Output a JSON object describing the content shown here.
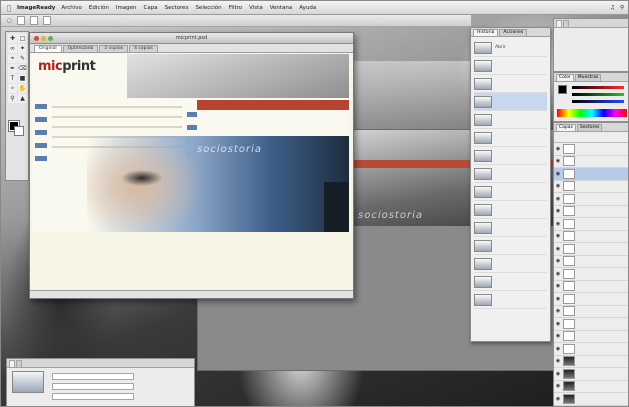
{
  "menubar": {
    "app_name": "ImageReady",
    "items": [
      "Archivo",
      "Edición",
      "Imagen",
      "Capa",
      "Sectores",
      "Selección",
      "Filtro",
      "Vista",
      "Ventana",
      "Ayuda"
    ]
  },
  "document": {
    "title": "micprint.psd",
    "tabs": [
      "Original",
      "Optimizada",
      "2 copias",
      "4 copias"
    ],
    "logo_part1": "mic",
    "logo_part2": "print",
    "hero_text": "sociostoria",
    "secondary_hero_text": "sociostoria"
  },
  "panels": {
    "history_tabs": [
      "Historia",
      "Acciones"
    ],
    "history_first_item": "Abrir",
    "color_tabs": [
      "Color",
      "Muestras"
    ],
    "layer_tabs": [
      "Capas",
      "Sectores"
    ]
  },
  "colors": {
    "logo_red": "#b22222",
    "accent_red": "#b8432e",
    "nav_blue": "#5a7fae",
    "selection": "#c7d7ef"
  }
}
